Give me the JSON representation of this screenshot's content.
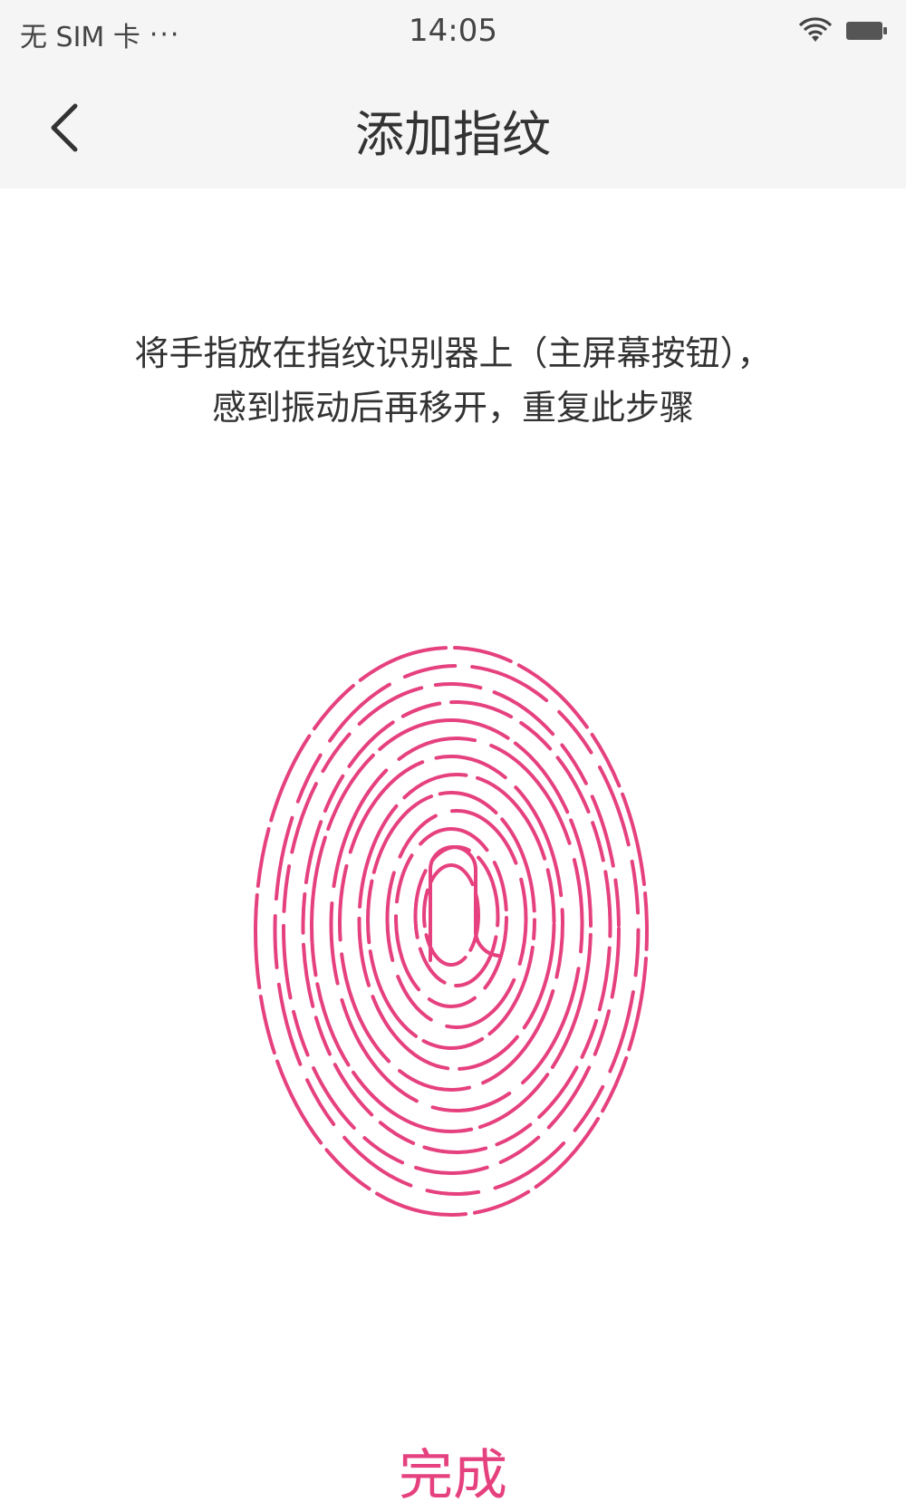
{
  "status_bar": {
    "carrier": "无 SIM 卡",
    "dots": "···",
    "time": "14:05",
    "wifi_icon": "wifi-icon",
    "battery_icon": "battery-icon"
  },
  "nav": {
    "back_icon": "chevron-left-icon",
    "title": "添加指纹"
  },
  "instructions": {
    "line1": "将手指放在指纹识别器上（主屏幕按钮），",
    "line2": "感到振动后再移开，重复此步骤"
  },
  "fingerprint": {
    "icon": "fingerprint-icon",
    "color": "#e6417f"
  },
  "done_label": "完成",
  "colors": {
    "accent": "#e6417f",
    "bar_bg": "#f5f5f5",
    "text": "#333333"
  }
}
